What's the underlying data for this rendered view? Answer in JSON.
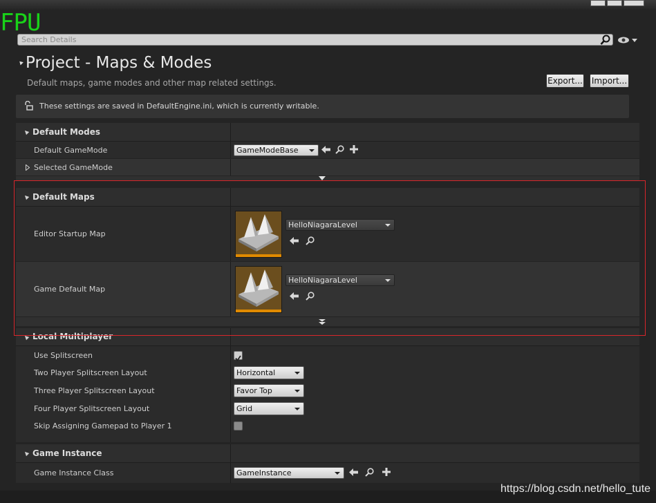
{
  "overlay_text": "FPU",
  "search": {
    "placeholder": "Search Details"
  },
  "header": {
    "title": "Project - Maps & Modes",
    "subtitle": "Default maps, game modes and other map related settings.",
    "export_label": "Export...",
    "import_label": "Import..."
  },
  "notice": "These settings are saved in DefaultEngine.ini, which is currently writable.",
  "sections": {
    "default_modes": {
      "title": "Default Modes",
      "rows": {
        "default_gamemode": {
          "label": "Default GameMode",
          "value": "GameModeBase"
        },
        "selected_gamemode": {
          "label": "Selected GameMode"
        }
      }
    },
    "default_maps": {
      "title": "Default Maps",
      "rows": {
        "editor_startup_map": {
          "label": "Editor Startup Map",
          "value": "HelloNiagaraLevel"
        },
        "game_default_map": {
          "label": "Game Default Map",
          "value": "HelloNiagaraLevel"
        }
      }
    },
    "local_multiplayer": {
      "title": "Local Multiplayer",
      "rows": {
        "use_splitscreen": {
          "label": "Use Splitscreen",
          "checked": true
        },
        "two_player": {
          "label": "Two Player Splitscreen Layout",
          "value": "Horizontal"
        },
        "three_player": {
          "label": "Three Player Splitscreen Layout",
          "value": "Favor Top"
        },
        "four_player": {
          "label": "Four Player Splitscreen Layout",
          "value": "Grid"
        },
        "skip_gamepad": {
          "label": "Skip Assigning Gamepad to Player 1",
          "checked": false
        }
      }
    },
    "game_instance": {
      "title": "Game Instance",
      "rows": {
        "game_instance_class": {
          "label": "Game Instance Class",
          "value": "GameInstance"
        }
      }
    }
  },
  "watermark": "https://blog.csdn.net/hello_tute",
  "colors": {
    "highlight_box": "#d9262b",
    "overlay_green": "#19d219",
    "thumbnail_bar": "#e08a00"
  }
}
